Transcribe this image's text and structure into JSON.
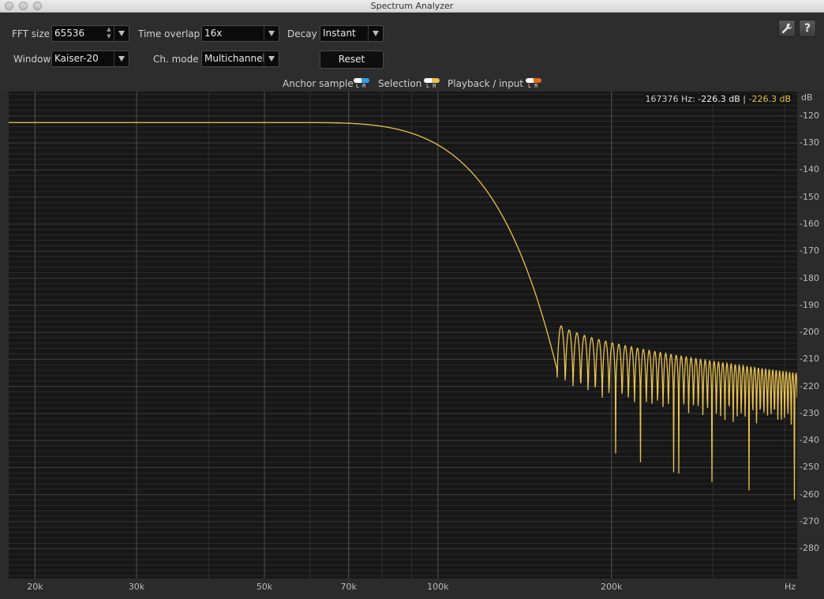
{
  "window": {
    "title": "Spectrum Analyzer"
  },
  "controls": {
    "fft_size": {
      "label": "FFT size",
      "value": "65536"
    },
    "time_overlap": {
      "label": "Time overlap",
      "value": "16x"
    },
    "decay": {
      "label": "Decay",
      "value": "Instant"
    },
    "window": {
      "label": "Window",
      "value": "Kaiser-20"
    },
    "ch_mode": {
      "label": "Ch. mode",
      "value": "Multichannel"
    },
    "reset_label": "Reset",
    "help_label": "?"
  },
  "legend": {
    "anchor": {
      "label": "Anchor sample",
      "color_l": "#ffffff",
      "color_r": "#2e9fe8"
    },
    "selection": {
      "label": "Selection",
      "color_l": "#ffffff",
      "color_r": "#e9c24f"
    },
    "playback": {
      "label": "Playback / input",
      "color_l": "#ffffff",
      "color_r": "#e86a1e"
    },
    "channel_l": "L",
    "channel_r": "R"
  },
  "readout": {
    "freq": "167376 Hz:",
    "value_l": "-226.3 dB",
    "sep": "|",
    "value_r": "-226.3 dB"
  },
  "chart_data": {
    "type": "line",
    "x_scale": "log",
    "x_unit_label": "Hz",
    "y_unit_label": "dB",
    "xlim": [
      18000,
      420000
    ],
    "ylim": [
      -291,
      -111
    ],
    "x_ticks": [
      {
        "value": 20000,
        "label": "20k"
      },
      {
        "value": 30000,
        "label": "30k"
      },
      {
        "value": 50000,
        "label": "50k"
      },
      {
        "value": 70000,
        "label": "70k"
      },
      {
        "value": 100000,
        "label": "100k"
      },
      {
        "value": 200000,
        "label": "200k"
      }
    ],
    "y_ticks": [
      -120,
      -130,
      -140,
      -150,
      -160,
      -170,
      -180,
      -190,
      -200,
      -210,
      -220,
      -230,
      -240,
      -250,
      -260,
      -270,
      -280
    ],
    "y_tick_labels": [
      "-120",
      "-130",
      "-140",
      "-150",
      "-160",
      "-170",
      "-180",
      "-190",
      "-200",
      "-210",
      "-220",
      "-230",
      "-240",
      "-250",
      "-260",
      "-270",
      "-280"
    ],
    "passband_level": -122.5,
    "cutoff_start_hz": 60000,
    "stopband_edge_hz": 161000,
    "sidelobe_start_hz": 161000,
    "sidelobe_spacing_hz": 5300,
    "sidelobe_peak_start": -196,
    "sidelobe_peak_end": -215,
    "null_depth_start": -228,
    "null_depth_end": -262,
    "series": [
      {
        "color": "#e9c24f"
      }
    ]
  }
}
